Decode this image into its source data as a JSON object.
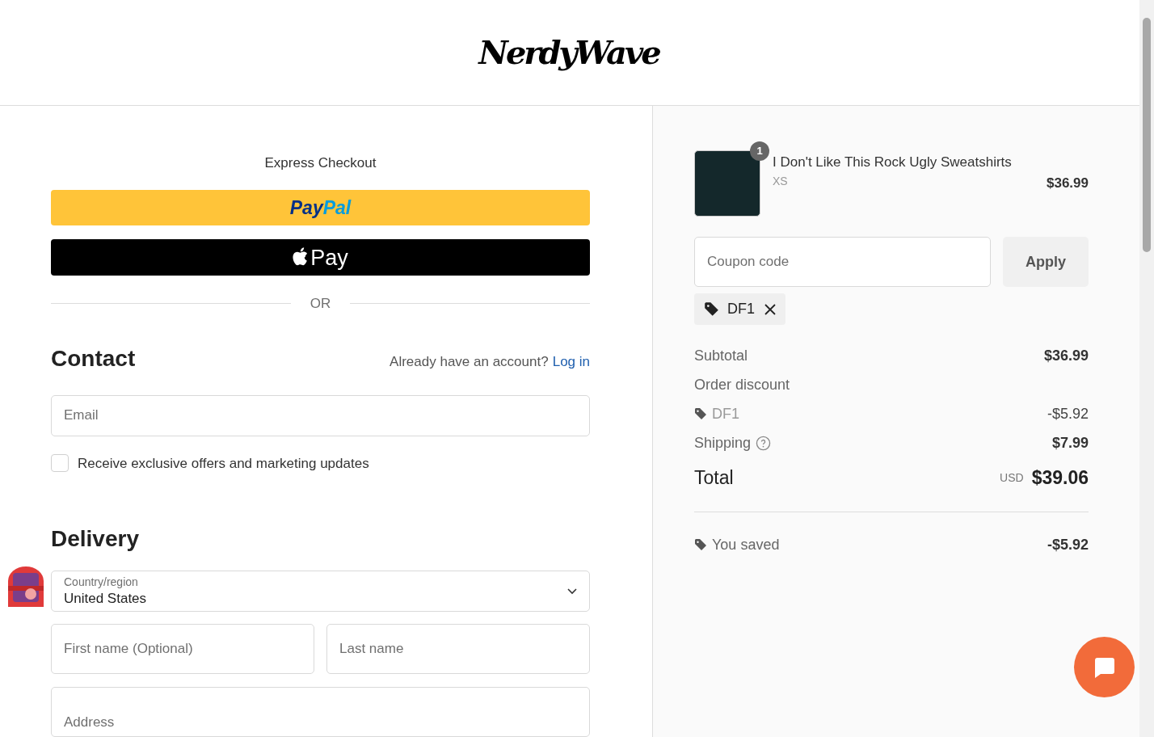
{
  "header": {
    "logo": "NerdyWave"
  },
  "express": {
    "title": "Express Checkout",
    "paypal": [
      "Pay",
      "Pal"
    ],
    "apple_pay": "Pay",
    "divider": "OR"
  },
  "contact": {
    "heading": "Contact",
    "account_prompt": "Already have an account?",
    "login_link": "Log in",
    "email": {
      "placeholder": "Email"
    },
    "marketing": {
      "label": "Receive exclusive offers and marketing updates",
      "checked": false
    }
  },
  "delivery": {
    "heading": "Delivery",
    "country": {
      "label": "Country/region",
      "value": "United States"
    },
    "first_name": {
      "placeholder": "First name (Optional)"
    },
    "last_name": {
      "placeholder": "Last name"
    },
    "address": {
      "placeholder": "Address"
    }
  },
  "summary": {
    "item": {
      "quantity": "1",
      "name": "I Don't Like This Rock Ugly Sweatshirts",
      "variant": "XS",
      "price": "$36.99"
    },
    "coupon": {
      "placeholder": "Coupon code",
      "button": "Apply"
    },
    "applied_codes": [
      {
        "code": "DF1"
      }
    ],
    "lines": [
      {
        "kind": "plain",
        "label": "Subtotal",
        "value": "$36.99"
      },
      {
        "kind": "heading",
        "label": "Order discount"
      },
      {
        "kind": "code",
        "label": "DF1",
        "value": "-$5.92"
      },
      {
        "kind": "help",
        "label": "Shipping",
        "value": "$7.99"
      }
    ],
    "total": {
      "label": "Total",
      "currency": "USD",
      "value": "$39.06"
    },
    "saved": {
      "label": "You saved",
      "value": "-$5.92"
    }
  }
}
